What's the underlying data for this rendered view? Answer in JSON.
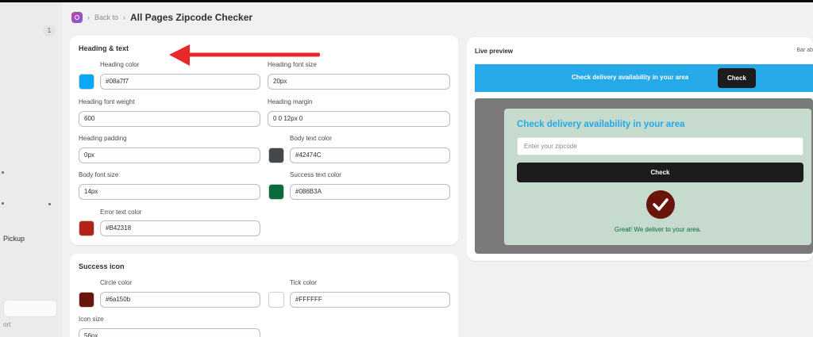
{
  "sidebar": {
    "badge": "1",
    "pickup_label": "Pickup",
    "port_label": "ort"
  },
  "header": {
    "back_label": "Back to",
    "title": "All Pages Zipcode Checker"
  },
  "heading_text": {
    "section_title": "Heading & text",
    "heading_color_label": "Heading color",
    "heading_color_value": "#08a7f7",
    "heading_font_size_label": "Heading font size",
    "heading_font_size_value": "20px",
    "heading_font_weight_label": "Heading font weight",
    "heading_font_weight_value": "600",
    "heading_margin_label": "Heading margin",
    "heading_margin_value": "0 0 12px 0",
    "heading_padding_label": "Heading padding",
    "heading_padding_value": "0px",
    "body_text_color_label": "Body text color",
    "body_text_color_value": "#42474C",
    "body_font_size_label": "Body font size",
    "body_font_size_value": "14px",
    "success_text_color_label": "Success text color",
    "success_text_color_value": "#086B3A",
    "error_text_color_label": "Error text color",
    "error_text_color_value": "#B42318"
  },
  "success_icon": {
    "section_title": "Success icon",
    "circle_color_label": "Circle color",
    "circle_color_value": "#6a150b",
    "tick_color_label": "Tick color",
    "tick_color_value": "#FFFFFF",
    "icon_size_label": "Icon size",
    "icon_size_value": "56px"
  },
  "live_preview": {
    "title": "Live preview",
    "right_label": "Bar ab",
    "bar_text": "Check delivery availability in your area",
    "bar_button": "Check",
    "modal_title": "Check delivery availability in your area",
    "modal_placeholder": "Enter your zipcode",
    "modal_button": "Check",
    "success_message": "Great! We deliver to your area."
  },
  "colors": {
    "heading_color": "#08a7f7",
    "body_text_color": "#42474C",
    "success_text_color": "#086B3A",
    "error_text_color": "#B42318",
    "circle_color": "#6a150b",
    "tick_color": "#FFFFFF",
    "preview_bar": "#25a9e9",
    "annotation_arrow": "#e8292c"
  }
}
